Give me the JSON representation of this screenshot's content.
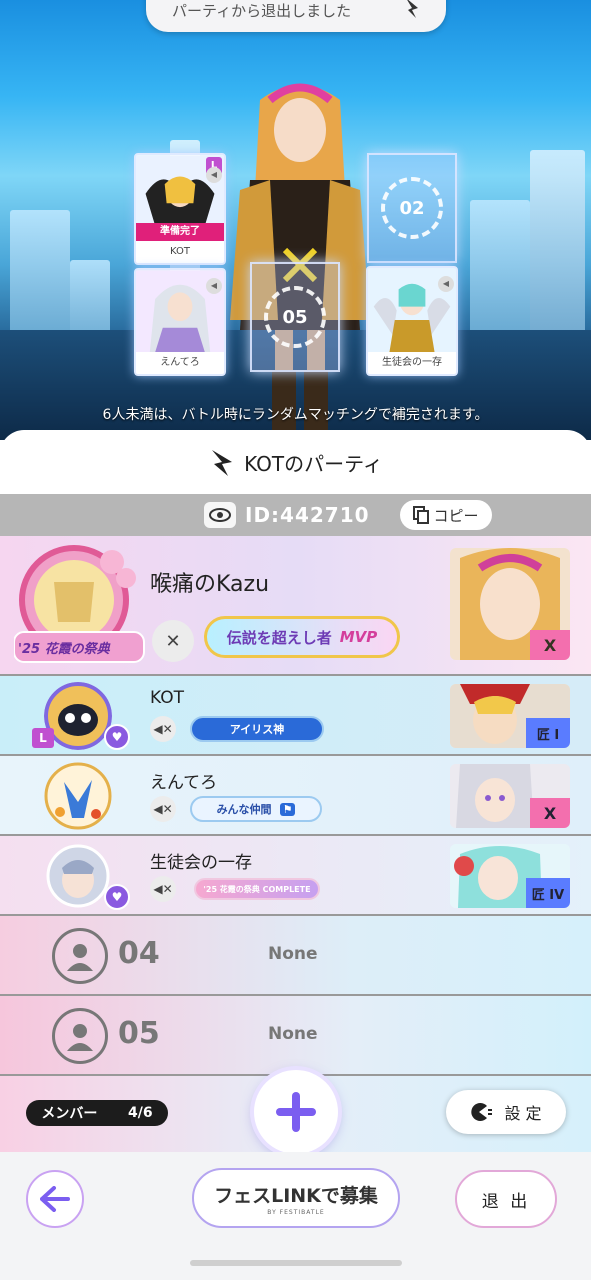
{
  "scene": {
    "toast": "パーティから退出しました",
    "notice": "6人未満は、バトル時にランダムマッチングで補完されます。",
    "slots": [
      {
        "label": "KOT",
        "status": "準備完了",
        "badge": "L"
      },
      {
        "label": "02"
      },
      {
        "label": "えんてろ"
      },
      {
        "label": "05"
      },
      {
        "label": "生徒会の一存"
      }
    ]
  },
  "panel": {
    "title": "KOTのパーティ",
    "id_text": "ID:442710",
    "copy_label": "コピー"
  },
  "members": [
    {
      "name": "喉痛のKazu",
      "title": "伝説を超えし者",
      "title_tag": "MVP",
      "event_badge": "'25 花霞の祭典",
      "rank": "X"
    },
    {
      "name": "KOT",
      "title": "アイリス神",
      "level_badge": "L",
      "rank": "匠 I"
    },
    {
      "name": "えんてろ",
      "title": "みんな仲間",
      "rank": "X"
    },
    {
      "name": "生徒会の一存",
      "title": "'25 花霞の祭典 COMPLETE",
      "rank": "匠 IV"
    }
  ],
  "empty_slots": [
    {
      "number": "04",
      "value": "None"
    },
    {
      "number": "05",
      "value": "None"
    }
  ],
  "footer": {
    "members_label": "メンバー",
    "members_count": "4/6",
    "settings_label": "設 定",
    "recruit_label": "フェスLINKで募集",
    "recruit_sub": "BY FESTIBATLE",
    "exit_label": "退 出"
  },
  "colors": {
    "accent": "#8a5ae0",
    "ready": "#e0207a",
    "plus": "#7b5ef0"
  }
}
